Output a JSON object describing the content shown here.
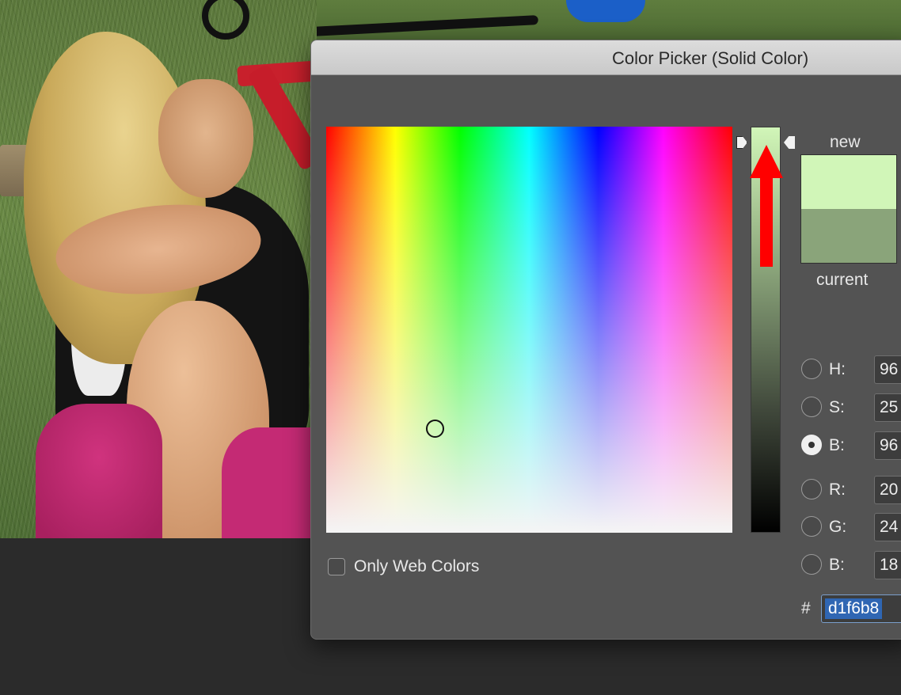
{
  "dialog": {
    "title": "Color Picker (Solid Color)",
    "only_web_colors_label": "Only Web Colors",
    "only_web_colors_checked": false
  },
  "swatches": {
    "new_label": "new",
    "current_label": "current",
    "new_color": "#d1f6b8",
    "current_color": "#8aa47a"
  },
  "fields": {
    "hsb": [
      {
        "label": "H:",
        "value": "96",
        "selected": false
      },
      {
        "label": "S:",
        "value": "25",
        "selected": false
      },
      {
        "label": "B:",
        "value": "96",
        "selected": true
      }
    ],
    "rgb": [
      {
        "label": "R:",
        "value": "20",
        "selected": false
      },
      {
        "label": "G:",
        "value": "24",
        "selected": false
      },
      {
        "label": "B:",
        "value": "18",
        "selected": false
      }
    ],
    "hex_prefix": "#",
    "hex_value": "d1f6b8"
  },
  "colors": {
    "dialog_bg": "#535353",
    "selection_blue": "#2f66b3",
    "annotation_arrow": "#ff0000"
  },
  "icons": {
    "slider_left_marker": "triangle-right-icon",
    "slider_right_marker": "triangle-left-icon",
    "annotation": "red-up-arrow-icon"
  }
}
